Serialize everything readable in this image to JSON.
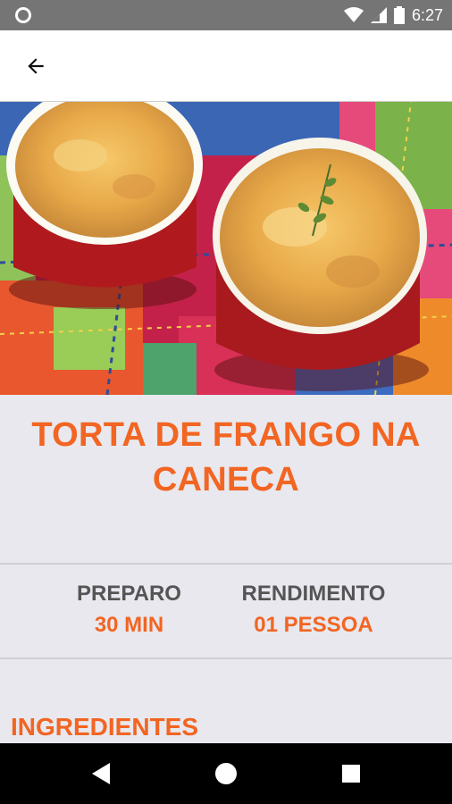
{
  "status_bar": {
    "time": "6:27",
    "icons": [
      "notification-circle-icon",
      "wifi-icon",
      "signal-icon",
      "battery-icon"
    ]
  },
  "app_bar": {
    "back_icon": "arrow-left-icon"
  },
  "recipe": {
    "title": "TORTA DE FRANGO NA CANECA",
    "image": "chicken-pot-pie-ramekins-photo"
  },
  "info": {
    "prep_label": "PREPARO",
    "prep_value": "30 MIN",
    "yield_label": "RENDIMENTO",
    "yield_value": "01 PESSOA"
  },
  "sections": {
    "ingredients_title": "INGREDIENTES"
  },
  "nav_bar": {
    "icons": [
      "back-triangle-icon",
      "home-circle-icon",
      "recents-square-icon"
    ]
  },
  "colors": {
    "accent": "#f26522",
    "status_bar": "#757575",
    "background": "#e8e8ee",
    "label_gray": "#555555"
  }
}
